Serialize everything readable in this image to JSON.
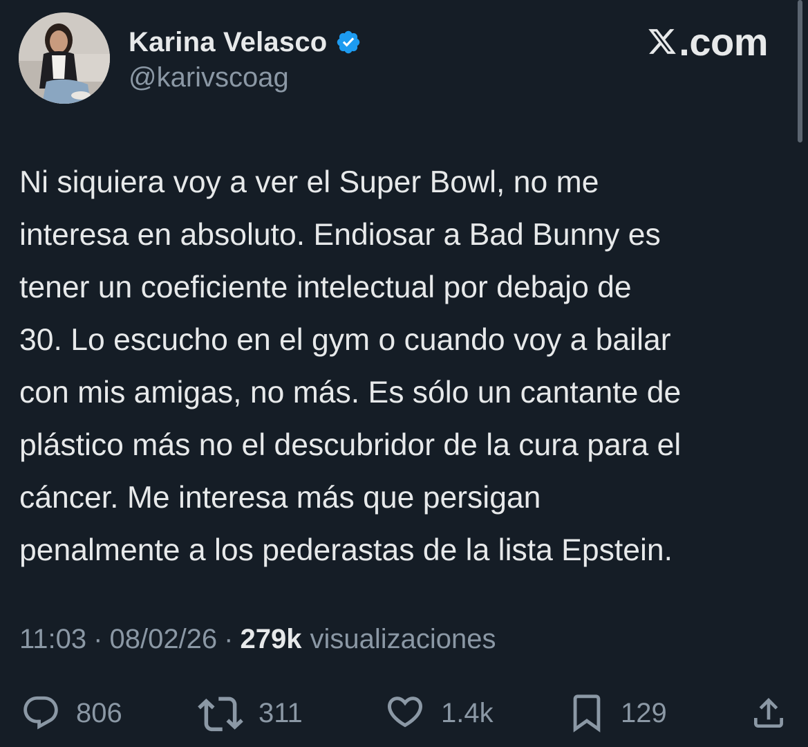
{
  "author": {
    "display_name": "Karina Velasco",
    "handle": "@karivscoag",
    "verified_icon": "verified-badge-icon",
    "verified_color": "#1d9bf0"
  },
  "brand": {
    "label": ".com",
    "icon": "x-logo-icon"
  },
  "tweet": {
    "lines": [
      "Ni siquiera voy a ver el Super Bowl, no me",
      "interesa en absoluto. Endiosar a Bad Bunny es",
      "tener un coeficiente intelectual por debajo de",
      "30. Lo escucho en el gym o cuando voy a bailar",
      "con mis amigas, no más. Es sólo un cantante de",
      "plástico más no el descubridor de la cura para el",
      "cáncer. Me interesa más que persigan",
      "penalmente a los pederastas de la lista Epstein."
    ]
  },
  "meta": {
    "time": "11:03",
    "separator": "·",
    "date": "08/02/26",
    "views_count": "279k",
    "views_label": "visualizaciones"
  },
  "actions": {
    "replies": {
      "icon": "reply-icon",
      "count": "806"
    },
    "retweets": {
      "icon": "retweet-icon",
      "count": "311"
    },
    "likes": {
      "icon": "heart-icon",
      "count": "1.4k"
    },
    "bookmarks": {
      "icon": "bookmark-icon",
      "count": "129"
    },
    "share": {
      "icon": "share-icon"
    }
  },
  "colors": {
    "background": "#151d26",
    "primary_text": "#e7e9ea",
    "secondary_text": "#8b98a5"
  }
}
